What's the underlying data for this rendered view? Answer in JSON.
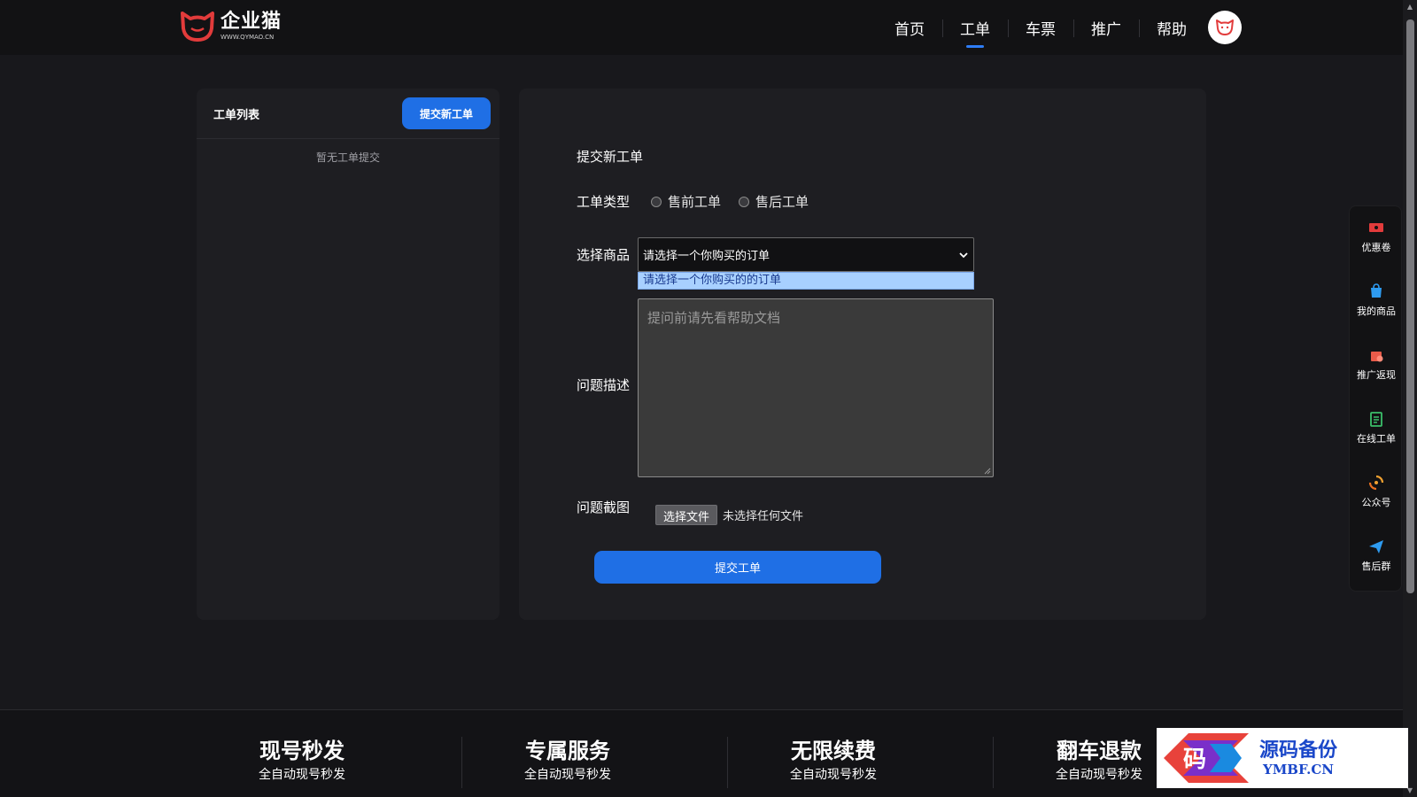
{
  "header": {
    "logo_name": "企业猫",
    "logo_url_text": "WWW.QYMAO.CN",
    "nav": [
      "首页",
      "工单",
      "车票",
      "推广",
      "帮助"
    ],
    "active_nav": "工单"
  },
  "ticket_list": {
    "title": "工单列表",
    "new_button": "提交新工单",
    "empty_text": "暂无工单提交"
  },
  "form": {
    "title": "提交新工单",
    "type_label": "工单类型",
    "type_options": [
      "售前工单",
      "售后工单"
    ],
    "product_label": "选择商品",
    "product_selected": "请选择一个你购买的订单",
    "product_options": [
      "请选择一个你购买的的订单"
    ],
    "description_label": "问题描述",
    "description_placeholder": "提问前请先看帮助文档",
    "screenshot_label": "问题截图",
    "file_button": "选择文件",
    "file_status": "未选择任何文件",
    "submit_button": "提交工单"
  },
  "sidebar": [
    {
      "label": "优惠卷",
      "icon": "ticket-icon"
    },
    {
      "label": "我的商品",
      "icon": "bag-icon"
    },
    {
      "label": "推广返现",
      "icon": "gift-icon"
    },
    {
      "label": "在线工单",
      "icon": "clipboard-icon"
    },
    {
      "label": "公众号",
      "icon": "swirl-icon"
    },
    {
      "label": "售后群",
      "icon": "send-icon"
    }
  ],
  "footer": {
    "features": [
      {
        "title": "现号秒发",
        "subtitle": "全自动现号秒发"
      },
      {
        "title": "专属服务",
        "subtitle": "全自动现号秒发"
      },
      {
        "title": "无限续费",
        "subtitle": "全自动现号秒发"
      },
      {
        "title": "翻车退款",
        "subtitle": "全自动现号秒发"
      }
    ]
  },
  "watermark": {
    "glyph": "码",
    "cn": "源码备份",
    "en": "YMBF.CN"
  },
  "colors": {
    "accent": "#1f6fe5",
    "background": "#18181c",
    "panel": "#1e1e22",
    "brand_red": "#e23b3b"
  }
}
